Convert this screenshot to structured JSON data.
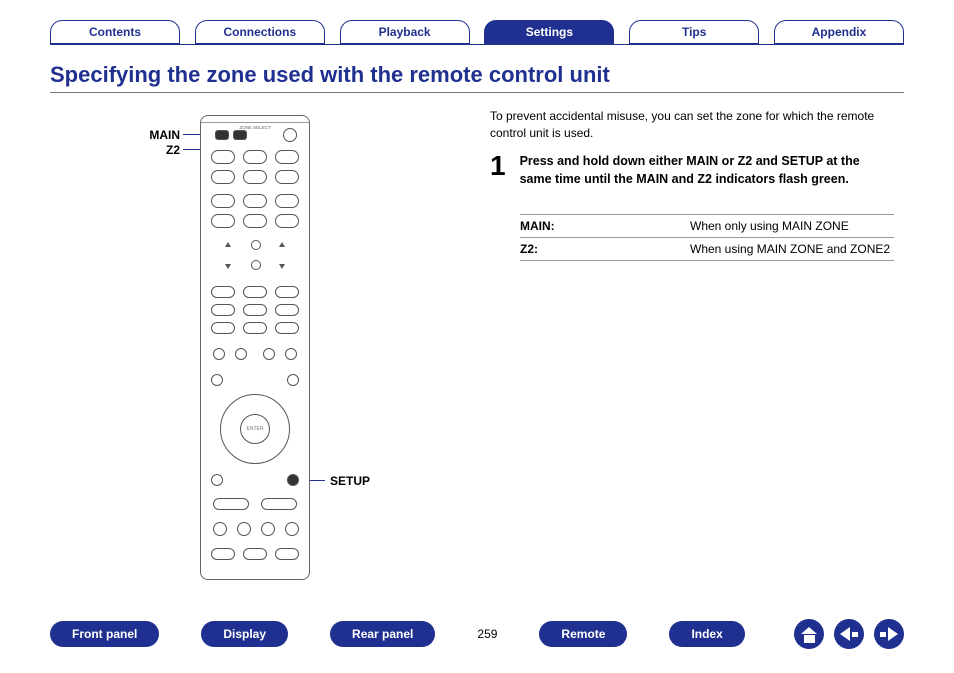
{
  "top_tabs": {
    "contents": "Contents",
    "connections": "Connections",
    "playback": "Playback",
    "settings": "Settings",
    "tips": "Tips",
    "appendix": "Appendix",
    "active": "settings"
  },
  "title": "Specifying the zone used with the remote control unit",
  "remote_callouts": {
    "main": "MAIN",
    "z2": "Z2",
    "setup": "SETUP",
    "zone_select": "ZONE SELECT",
    "enter": "ENTER"
  },
  "intro": "To prevent accidental misuse, you can set the zone for which the remote control unit is used.",
  "step": {
    "num": "1",
    "text": "Press and hold down either MAIN or Z2 and SETUP at the same time until the MAIN and Z2 indicators flash green."
  },
  "definitions": [
    {
      "term": "MAIN:",
      "desc": "When only using MAIN ZONE"
    },
    {
      "term": "Z2:",
      "desc": "When using MAIN ZONE and ZONE2"
    }
  ],
  "bottom_nav": {
    "front_panel": "Front panel",
    "display": "Display",
    "rear_panel": "Rear panel",
    "remote": "Remote",
    "index": "Index"
  },
  "page_number": "259"
}
